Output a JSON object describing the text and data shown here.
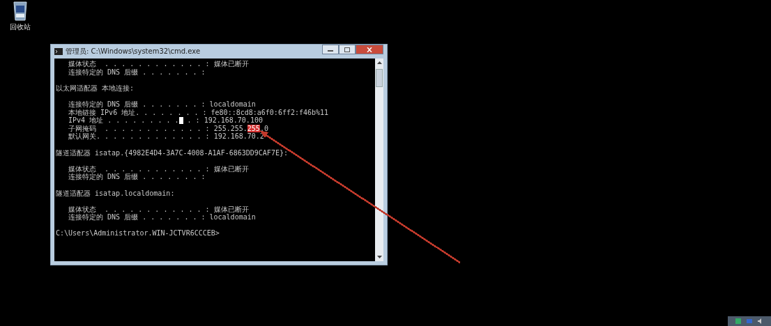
{
  "desktop": {
    "icons": [
      {
        "label": "回收站"
      }
    ]
  },
  "console_window": {
    "title": "管理员: C:\\Windows\\system32\\cmd.exe",
    "lines": [
      {
        "segments": [
          {
            "text": "   媒体状态  . . . . . . . . . . . . : 媒体已断开"
          }
        ]
      },
      {
        "segments": [
          {
            "text": "   连接特定的 DNS 后缀 . . . . . . . :"
          }
        ]
      },
      {
        "blank_before": true,
        "segments": [
          {
            "text": "以太网适配器 本地连接:"
          }
        ]
      },
      {
        "blank_before": true,
        "segments": [
          {
            "text": "   连接特定的 DNS 后缀 . . . . . . . : localdomain"
          }
        ]
      },
      {
        "segments": [
          {
            "text": "   本地链接 IPv6 地址. . . . . . . . : fe80::8cd8:a6f0:6ff2:f46b%11"
          }
        ]
      },
      {
        "segments": [
          {
            "text": "   IPv4 地址 . . . . . . . . ."
          },
          {
            "kind": "cursor"
          },
          {
            "text": " . : 192.168.70.100"
          }
        ]
      },
      {
        "segments": [
          {
            "text": "   子网掩码  . . . . . . . . . . . . : 255.255."
          },
          {
            "text": "255",
            "highlighted": true
          },
          {
            "text": ".0"
          }
        ]
      },
      {
        "segments": [
          {
            "text": "   默认网关. . . . . . . . . . . . . : 192.168.70.2"
          }
        ]
      },
      {
        "blank_before": true,
        "segments": [
          {
            "text": "隧道适配器 isatap.{4982E4D4-3A7C-4008-A1AF-6863DD9CAF7E}:"
          }
        ]
      },
      {
        "blank_before": true,
        "segments": [
          {
            "text": "   媒体状态  . . . . . . . . . . . . : 媒体已断开"
          }
        ]
      },
      {
        "segments": [
          {
            "text": "   连接特定的 DNS 后缀 . . . . . . . :"
          }
        ]
      },
      {
        "blank_before": true,
        "segments": [
          {
            "text": "隧道适配器 isatap.localdomain:"
          }
        ]
      },
      {
        "blank_before": true,
        "segments": [
          {
            "text": "   媒体状态  . . . . . . . . . . . . : 媒体已断开"
          }
        ]
      },
      {
        "segments": [
          {
            "text": "   连接特定的 DNS 后缀 . . . . . . . : localdomain"
          }
        ]
      },
      {
        "blank_before": true,
        "segments": [
          {
            "text": "C:\\Users\\Administrator.WIN-JCTVR6CCCEB>"
          }
        ]
      }
    ]
  },
  "annotation": {
    "kind": "arrow",
    "color": "#c0392b"
  }
}
